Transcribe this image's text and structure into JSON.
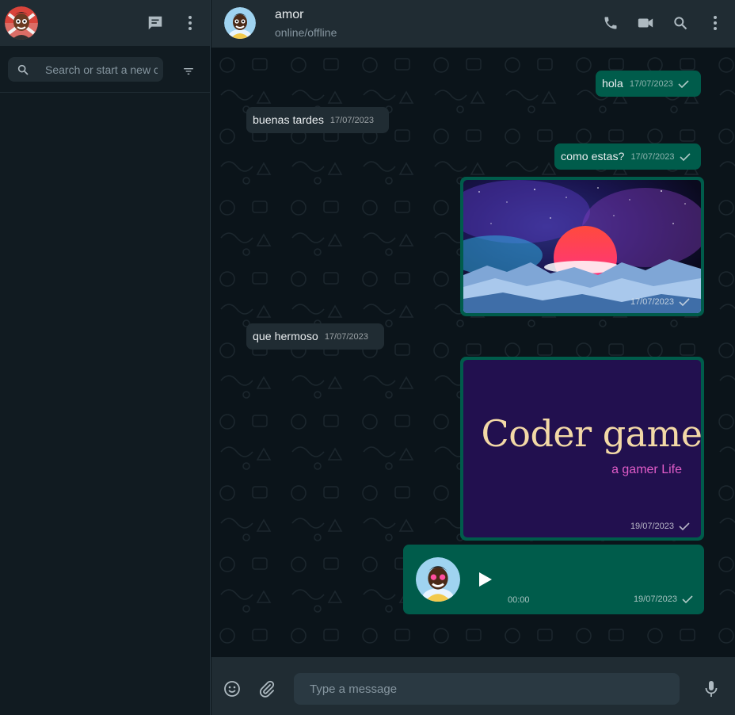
{
  "sidebar": {
    "search_placeholder": "Search or start a new chat"
  },
  "chat": {
    "contact_name": "amor",
    "contact_status": "online/offline"
  },
  "messages": [
    {
      "text": "hola",
      "time": "17/07/2023",
      "direction": "outgoing"
    },
    {
      "text": "buenas tardes",
      "time": "17/07/2023",
      "direction": "incoming"
    },
    {
      "text": "como estas?",
      "time": "17/07/2023",
      "direction": "outgoing"
    },
    {
      "type": "image",
      "time": "17/07/2023",
      "direction": "outgoing"
    },
    {
      "text": "que hermoso",
      "time": "17/07/2023",
      "direction": "incoming"
    },
    {
      "type": "image",
      "title": "Coder game",
      "subtitle": "a gamer Life",
      "time": "19/07/2023",
      "direction": "outgoing"
    },
    {
      "type": "audio",
      "duration": "00:00",
      "time": "19/07/2023",
      "direction": "outgoing"
    }
  ],
  "composer": {
    "placeholder": "Type a message"
  },
  "colors": {
    "outgoing_bubble": "#005c4b",
    "incoming_bubble": "#202c33",
    "panel": "#202c33",
    "background": "#0b141a",
    "sidebar": "#111b21"
  },
  "icons": [
    "new-chat-icon",
    "menu-icon",
    "search-icon",
    "filter-icon",
    "phone-icon",
    "video-call-icon",
    "chat-search-icon",
    "chat-menu-icon",
    "emoji-icon",
    "attach-icon",
    "mic-icon",
    "play-icon",
    "read-tick-icon"
  ]
}
